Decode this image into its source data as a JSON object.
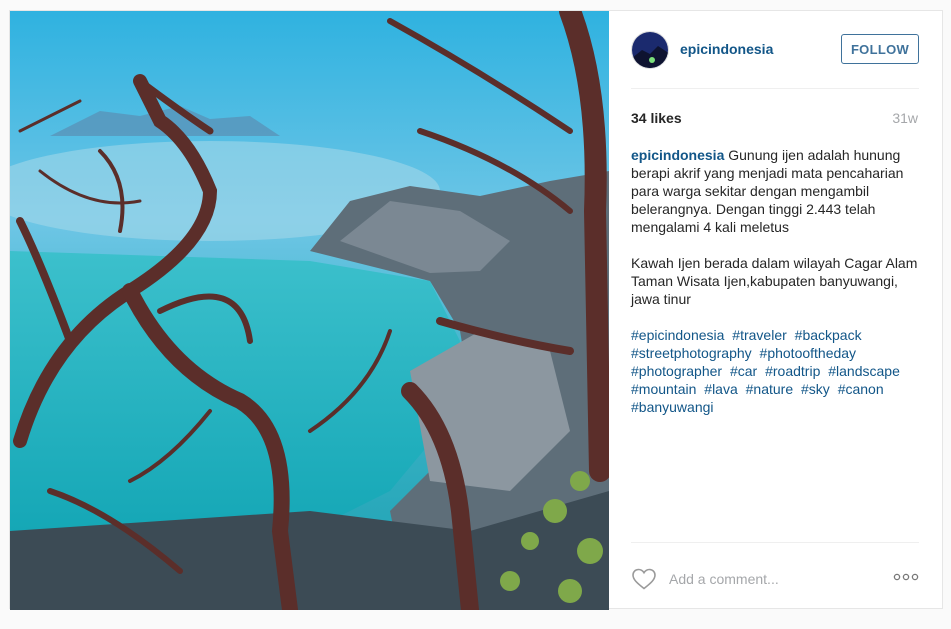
{
  "post": {
    "username": "epicindonesia",
    "follow_label": "FOLLOW",
    "likes": "34 likes",
    "timestamp": "31w",
    "caption": {
      "username": "epicindonesia",
      "paragraph1": "Gunung ijen adalah hunung berapi akrif yang menjadi mata pencaharian para warga sekitar dengan mengambil belerangnya. Dengan tinggi 2.443 telah mengalami 4 kali meletus",
      "paragraph2": "Kawah Ijen berada dalam wilayah Cagar Alam Taman Wisata Ijen,kabupaten banyuwangi, jawa tinur",
      "hashtags": [
        "#epicindonesia",
        "#traveler",
        "#backpack",
        "#streetphotography",
        "#photooftheday",
        "#photographer",
        "#car",
        "#roadtrip",
        "#landscape",
        "#mountain",
        "#lava",
        "#nature",
        "#sky",
        "#canon",
        "#banyuwangi"
      ]
    },
    "comment_placeholder": "Add a comment...",
    "icons": {
      "like": "heart-outline-icon",
      "more": "more-options-icon"
    }
  },
  "colors": {
    "link": "#125688",
    "follow_border": "#3f729b",
    "muted": "#a5a7aa"
  }
}
